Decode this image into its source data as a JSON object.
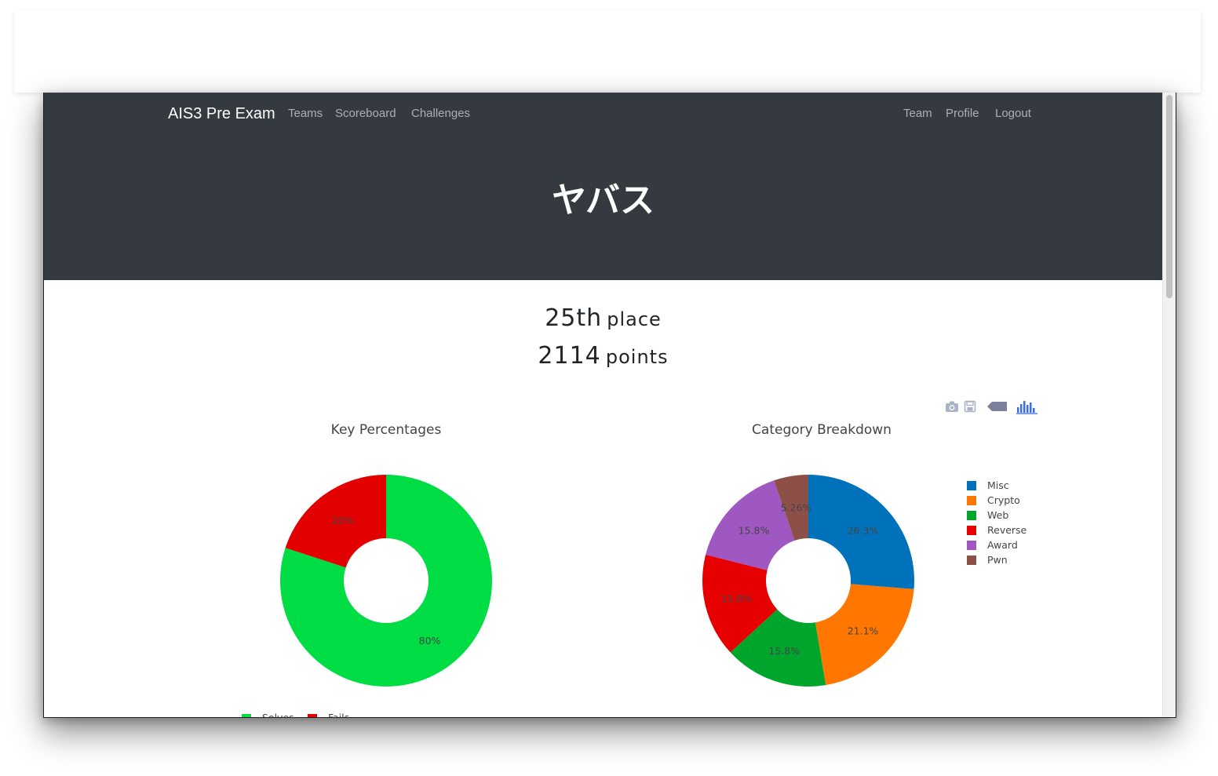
{
  "navbar": {
    "brand": "AIS3 Pre Exam",
    "left_links": [
      "Teams",
      "Scoreboard",
      "Challenges"
    ],
    "right_links": [
      "Team",
      "Profile",
      "Logout"
    ]
  },
  "team": {
    "name": "ヤバス",
    "place_number": "25th",
    "place_suffix": "place",
    "points_number": "2114",
    "points_suffix": "points"
  },
  "modebar": {
    "icons": [
      "camera-icon",
      "save-icon",
      "tag-icon",
      "plotly-logo-icon"
    ]
  },
  "colors": {
    "navbar_bg": "#343a40",
    "solves": "#00dd44",
    "fails": "#e30000",
    "misc": "#0072bc",
    "crypto": "#ff7600",
    "web": "#00a62c",
    "reverse": "#e60000",
    "award": "#9f58c2",
    "pwn": "#8d5048"
  },
  "chart_data": [
    {
      "type": "pie",
      "title": "Key Percentages",
      "hole": true,
      "labels": [
        "Solves",
        "Fails"
      ],
      "values": [
        80,
        20
      ],
      "text_labels": [
        "80%",
        "20%"
      ],
      "colors": [
        "#00dd44",
        "#e30000"
      ],
      "legend_placement": "bottom"
    },
    {
      "type": "pie",
      "title": "Category Breakdown",
      "hole": true,
      "labels": [
        "Misc",
        "Crypto",
        "Web",
        "Reverse",
        "Award",
        "Pwn"
      ],
      "values": [
        26.3,
        21.1,
        15.8,
        15.8,
        15.8,
        5.26
      ],
      "text_labels": [
        "26.3%",
        "21.1%",
        "15.8%",
        "15.8%",
        "15.8%",
        "5.26%"
      ],
      "colors": [
        "#0072bc",
        "#ff7600",
        "#00a62c",
        "#e60000",
        "#9f58c2",
        "#8d5048"
      ],
      "legend_placement": "right"
    }
  ]
}
